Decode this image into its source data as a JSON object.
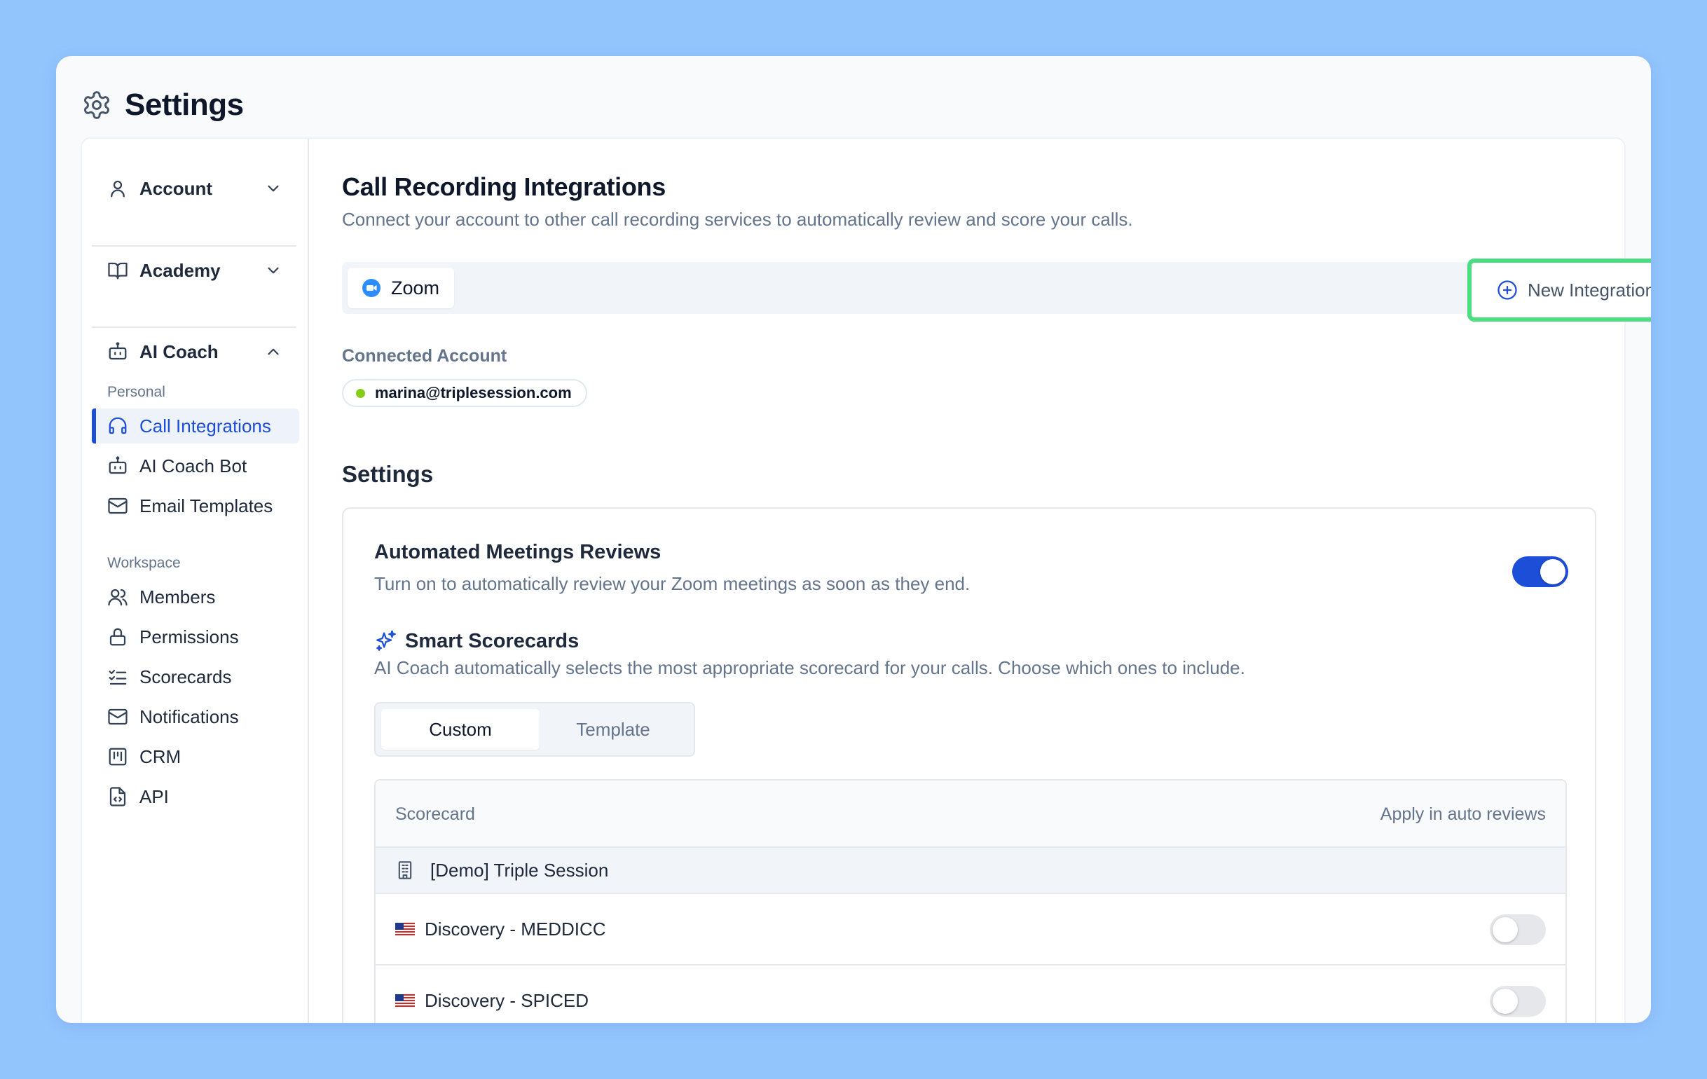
{
  "window": {
    "title": "Settings"
  },
  "sidebar": {
    "sections": [
      {
        "label": "Account",
        "icon": "user-icon",
        "expanded": false
      },
      {
        "label": "Academy",
        "icon": "book-icon",
        "expanded": false
      },
      {
        "label": "AI Coach",
        "icon": "bot-icon",
        "expanded": true
      }
    ],
    "personal_label": "Personal",
    "personal_items": [
      {
        "label": "Call Integrations",
        "icon": "headset-icon",
        "active": true
      },
      {
        "label": "AI Coach Bot",
        "icon": "bot-icon",
        "active": false
      },
      {
        "label": "Email Templates",
        "icon": "mail-icon",
        "active": false
      }
    ],
    "workspace_label": "Workspace",
    "workspace_items": [
      {
        "label": "Members",
        "icon": "users-icon"
      },
      {
        "label": "Permissions",
        "icon": "lock-icon"
      },
      {
        "label": "Scorecards",
        "icon": "checklist-icon"
      },
      {
        "label": "Notifications",
        "icon": "mail-icon"
      },
      {
        "label": "CRM",
        "icon": "kanban-icon"
      },
      {
        "label": "API",
        "icon": "file-code-icon"
      }
    ]
  },
  "main": {
    "title": "Call Recording Integrations",
    "subtitle": "Connect your account to other call recording services to automatically review and score your calls.",
    "integrations": [
      {
        "label": "Zoom",
        "icon": "zoom-icon"
      }
    ],
    "new_integration_label": "New Integration",
    "connected_account_label": "Connected Account",
    "connected_account_email": "marina@triplesession.com",
    "connected_status_color": "#84cc16",
    "settings_heading": "Settings",
    "automated_reviews": {
      "title": "Automated Meetings Reviews",
      "description": "Turn on to automatically review your Zoom meetings as soon as they end.",
      "enabled": true
    },
    "smart_scorecards": {
      "title": "Smart Scorecards",
      "description": "AI Coach automatically selects the most appropriate scorecard for your calls. Choose which ones to include.",
      "tabs": [
        {
          "label": "Custom",
          "active": true
        },
        {
          "label": "Template",
          "active": false
        }
      ]
    },
    "table": {
      "col_scorecard": "Scorecard",
      "col_apply": "Apply in auto reviews",
      "group": {
        "label": "[Demo] Triple Session",
        "icon": "building-icon"
      },
      "rows": [
        {
          "label": "Discovery - MEDDICC",
          "flag": "us-flag-icon",
          "enabled": false
        },
        {
          "label": "Discovery - SPICED",
          "flag": "us-flag-icon",
          "enabled": false
        }
      ]
    }
  },
  "colors": {
    "accent": "#1d4ed8",
    "highlight_border": "#4ade80",
    "page_bg": "#93c5fd"
  }
}
